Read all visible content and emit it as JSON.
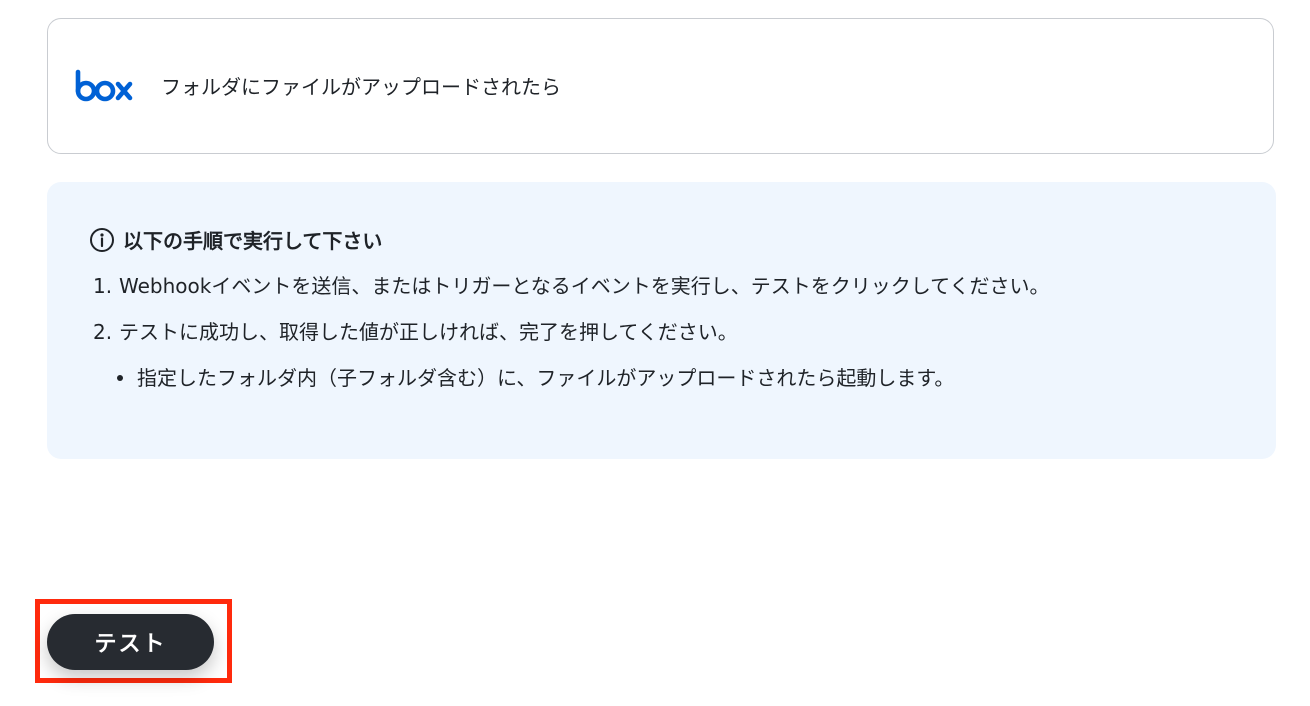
{
  "trigger": {
    "app_icon": "box-logo",
    "label": "フォルダにファイルがアップロードされたら"
  },
  "instructions": {
    "heading_icon": "info-icon",
    "heading": "以下の手順で実行して下さい",
    "steps": [
      {
        "number": "1.",
        "text": "Webhookイベントを送信、またはトリガーとなるイベントを実行し、テストをクリックしてください。"
      },
      {
        "number": "2.",
        "text": "テストに成功し、取得した値が正しければ、完了を押してください。"
      }
    ],
    "bullets": [
      "指定したフォルダ内（子フォルダ含む）に、ファイルがアップロードされたら起動します。"
    ]
  },
  "actions": {
    "test_label": "テスト"
  },
  "colors": {
    "box_brand": "#0061d5",
    "info_background": "#eff6fe",
    "button_background": "#272b31",
    "highlight": "#ff2a0d"
  }
}
